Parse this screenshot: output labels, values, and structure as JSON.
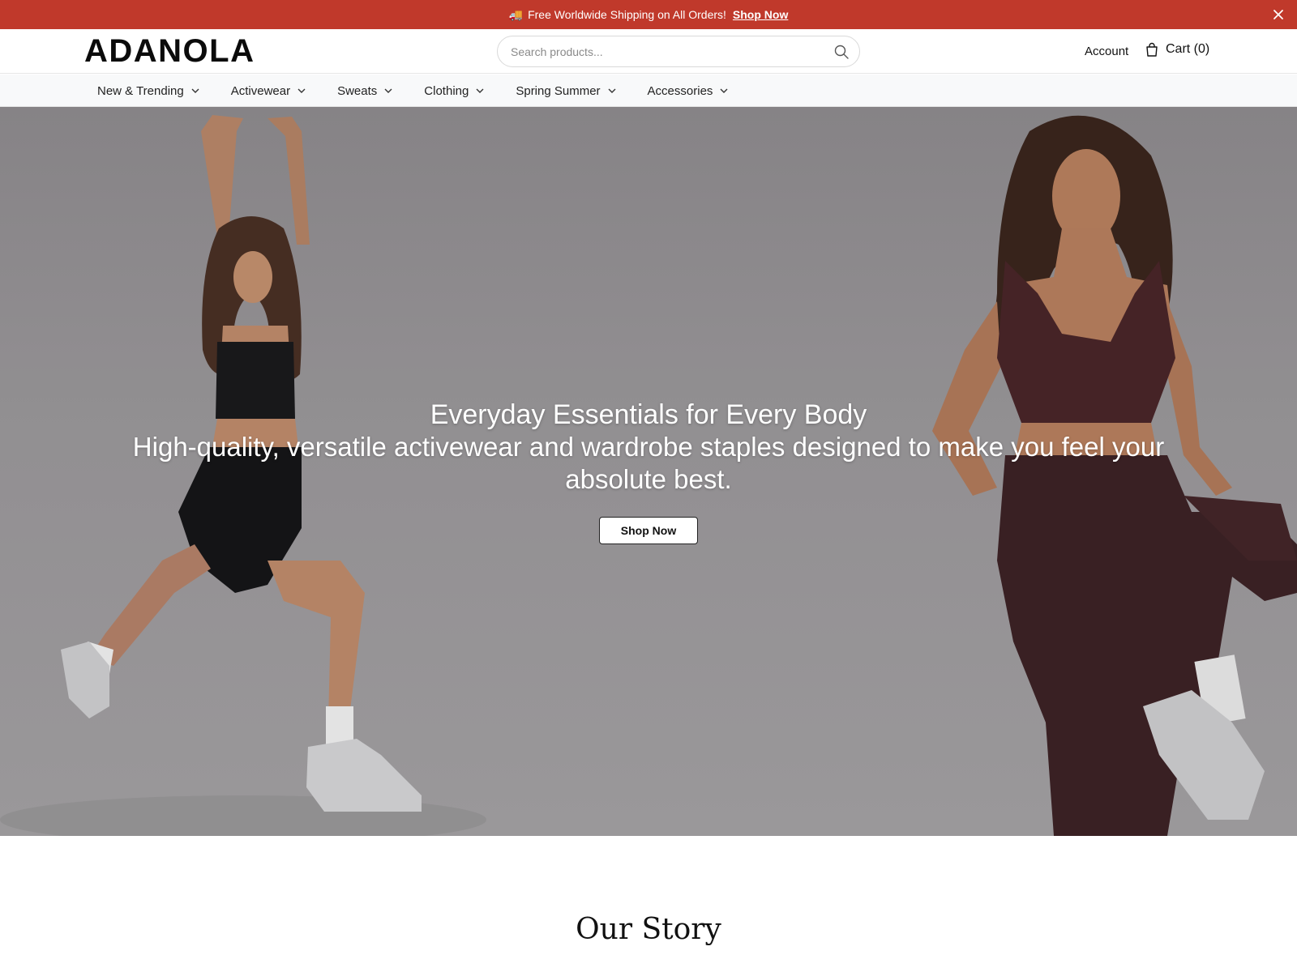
{
  "announcement": {
    "icon": "truck-icon",
    "message": "Free Worldwide Shipping on All Orders!",
    "link_label": "Shop Now",
    "background": "#c0392b"
  },
  "header": {
    "logo": "ADANOLA",
    "search": {
      "placeholder": "Search products...",
      "value": ""
    },
    "account_label": "Account",
    "cart_label": "Cart (0)"
  },
  "nav": {
    "items": [
      {
        "label": "New & Trending"
      },
      {
        "label": "Activewear"
      },
      {
        "label": "Sweats"
      },
      {
        "label": "Clothing"
      },
      {
        "label": "Spring Summer"
      },
      {
        "label": "Accessories"
      }
    ]
  },
  "hero": {
    "title": "Everyday Essentials for Every Body",
    "subtitle": "High-quality, versatile activewear and wardrobe staples designed to make you feel your absolute best.",
    "cta_label": "Shop Now"
  },
  "story": {
    "title": "Our Story"
  }
}
